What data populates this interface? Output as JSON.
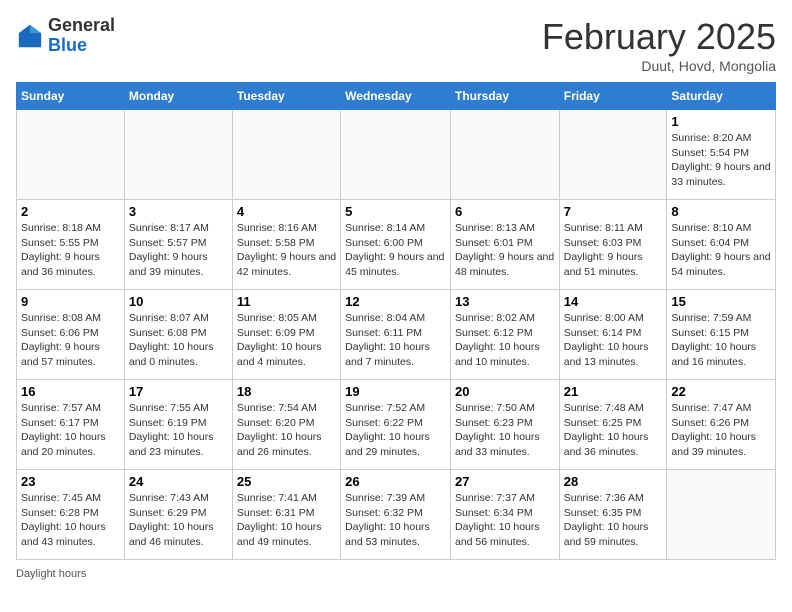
{
  "header": {
    "logo_general": "General",
    "logo_blue": "Blue",
    "month_title": "February 2025",
    "subtitle": "Duut, Hovd, Mongolia"
  },
  "weekdays": [
    "Sunday",
    "Monday",
    "Tuesday",
    "Wednesday",
    "Thursday",
    "Friday",
    "Saturday"
  ],
  "weeks": [
    [
      {
        "day": "",
        "info": ""
      },
      {
        "day": "",
        "info": ""
      },
      {
        "day": "",
        "info": ""
      },
      {
        "day": "",
        "info": ""
      },
      {
        "day": "",
        "info": ""
      },
      {
        "day": "",
        "info": ""
      },
      {
        "day": "1",
        "info": "Sunrise: 8:20 AM\nSunset: 5:54 PM\nDaylight: 9 hours and 33 minutes."
      }
    ],
    [
      {
        "day": "2",
        "info": "Sunrise: 8:18 AM\nSunset: 5:55 PM\nDaylight: 9 hours and 36 minutes."
      },
      {
        "day": "3",
        "info": "Sunrise: 8:17 AM\nSunset: 5:57 PM\nDaylight: 9 hours and 39 minutes."
      },
      {
        "day": "4",
        "info": "Sunrise: 8:16 AM\nSunset: 5:58 PM\nDaylight: 9 hours and 42 minutes."
      },
      {
        "day": "5",
        "info": "Sunrise: 8:14 AM\nSunset: 6:00 PM\nDaylight: 9 hours and 45 minutes."
      },
      {
        "day": "6",
        "info": "Sunrise: 8:13 AM\nSunset: 6:01 PM\nDaylight: 9 hours and 48 minutes."
      },
      {
        "day": "7",
        "info": "Sunrise: 8:11 AM\nSunset: 6:03 PM\nDaylight: 9 hours and 51 minutes."
      },
      {
        "day": "8",
        "info": "Sunrise: 8:10 AM\nSunset: 6:04 PM\nDaylight: 9 hours and 54 minutes."
      }
    ],
    [
      {
        "day": "9",
        "info": "Sunrise: 8:08 AM\nSunset: 6:06 PM\nDaylight: 9 hours and 57 minutes."
      },
      {
        "day": "10",
        "info": "Sunrise: 8:07 AM\nSunset: 6:08 PM\nDaylight: 10 hours and 0 minutes."
      },
      {
        "day": "11",
        "info": "Sunrise: 8:05 AM\nSunset: 6:09 PM\nDaylight: 10 hours and 4 minutes."
      },
      {
        "day": "12",
        "info": "Sunrise: 8:04 AM\nSunset: 6:11 PM\nDaylight: 10 hours and 7 minutes."
      },
      {
        "day": "13",
        "info": "Sunrise: 8:02 AM\nSunset: 6:12 PM\nDaylight: 10 hours and 10 minutes."
      },
      {
        "day": "14",
        "info": "Sunrise: 8:00 AM\nSunset: 6:14 PM\nDaylight: 10 hours and 13 minutes."
      },
      {
        "day": "15",
        "info": "Sunrise: 7:59 AM\nSunset: 6:15 PM\nDaylight: 10 hours and 16 minutes."
      }
    ],
    [
      {
        "day": "16",
        "info": "Sunrise: 7:57 AM\nSunset: 6:17 PM\nDaylight: 10 hours and 20 minutes."
      },
      {
        "day": "17",
        "info": "Sunrise: 7:55 AM\nSunset: 6:19 PM\nDaylight: 10 hours and 23 minutes."
      },
      {
        "day": "18",
        "info": "Sunrise: 7:54 AM\nSunset: 6:20 PM\nDaylight: 10 hours and 26 minutes."
      },
      {
        "day": "19",
        "info": "Sunrise: 7:52 AM\nSunset: 6:22 PM\nDaylight: 10 hours and 29 minutes."
      },
      {
        "day": "20",
        "info": "Sunrise: 7:50 AM\nSunset: 6:23 PM\nDaylight: 10 hours and 33 minutes."
      },
      {
        "day": "21",
        "info": "Sunrise: 7:48 AM\nSunset: 6:25 PM\nDaylight: 10 hours and 36 minutes."
      },
      {
        "day": "22",
        "info": "Sunrise: 7:47 AM\nSunset: 6:26 PM\nDaylight: 10 hours and 39 minutes."
      }
    ],
    [
      {
        "day": "23",
        "info": "Sunrise: 7:45 AM\nSunset: 6:28 PM\nDaylight: 10 hours and 43 minutes."
      },
      {
        "day": "24",
        "info": "Sunrise: 7:43 AM\nSunset: 6:29 PM\nDaylight: 10 hours and 46 minutes."
      },
      {
        "day": "25",
        "info": "Sunrise: 7:41 AM\nSunset: 6:31 PM\nDaylight: 10 hours and 49 minutes."
      },
      {
        "day": "26",
        "info": "Sunrise: 7:39 AM\nSunset: 6:32 PM\nDaylight: 10 hours and 53 minutes."
      },
      {
        "day": "27",
        "info": "Sunrise: 7:37 AM\nSunset: 6:34 PM\nDaylight: 10 hours and 56 minutes."
      },
      {
        "day": "28",
        "info": "Sunrise: 7:36 AM\nSunset: 6:35 PM\nDaylight: 10 hours and 59 minutes."
      },
      {
        "day": "",
        "info": ""
      }
    ]
  ],
  "footer": {
    "note": "Daylight hours"
  }
}
